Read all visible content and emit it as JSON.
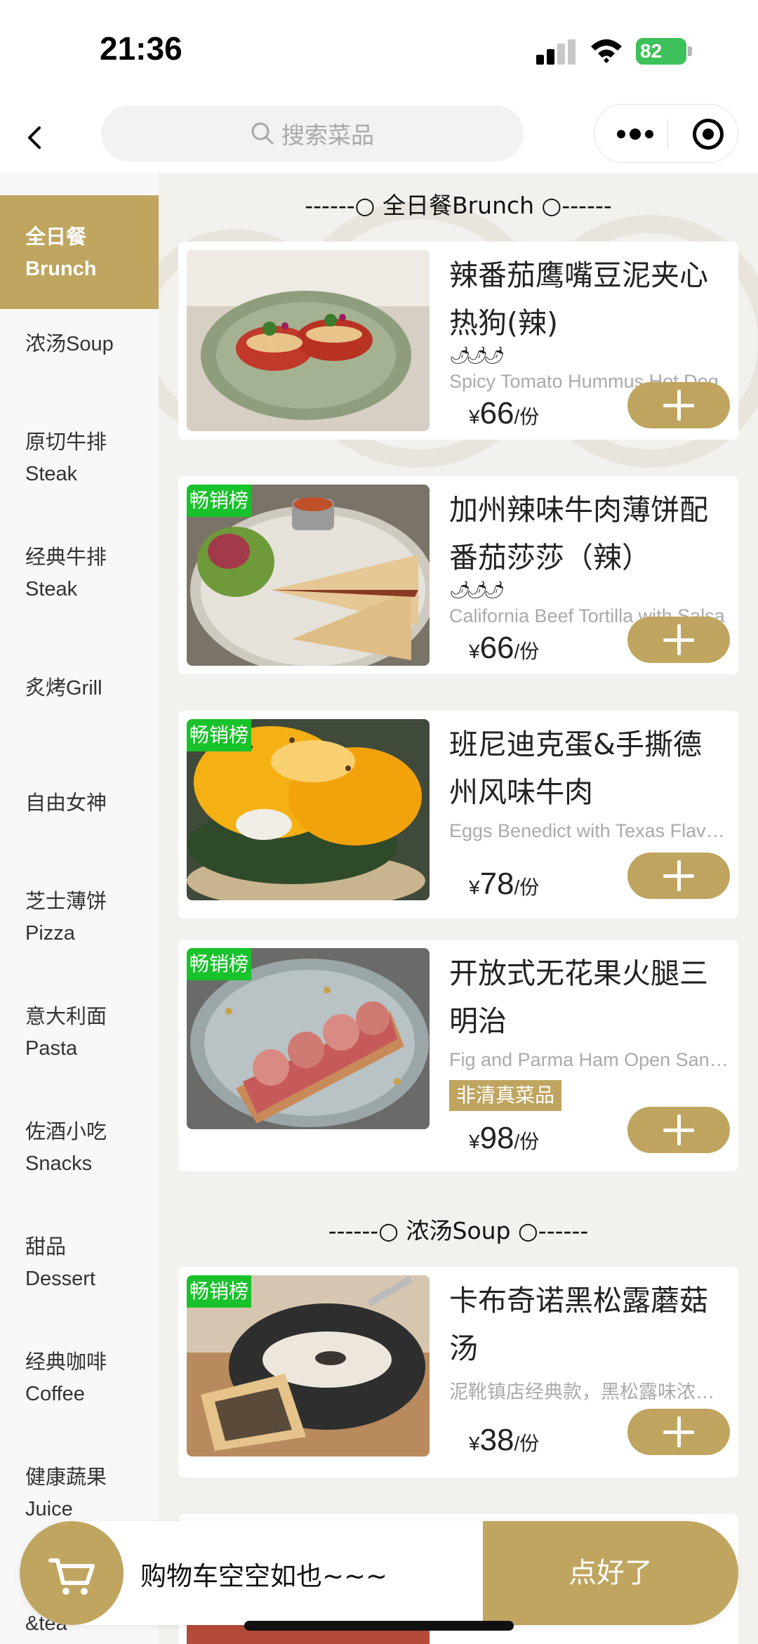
{
  "status_bar": {
    "time": "21:36",
    "battery": "82"
  },
  "nav": {
    "search_placeholder": "搜索菜品"
  },
  "categories": [
    {
      "l1": "全日餐",
      "l2": "Brunch",
      "active": true
    },
    {
      "l1": "浓汤Soup",
      "l2": ""
    },
    {
      "l1": "原切牛排",
      "l2": "Steak"
    },
    {
      "l1": "经典牛排",
      "l2": "Steak"
    },
    {
      "l1": "炙烤Grill",
      "l2": ""
    },
    {
      "l1": "自由女神",
      "l2": ""
    },
    {
      "l1": "芝士薄饼",
      "l2": "Pizza"
    },
    {
      "l1": "意大利面",
      "l2": "Pasta"
    },
    {
      "l1": "佐酒小吃",
      "l2": "Snacks"
    },
    {
      "l1": "甜品",
      "l2": "Dessert"
    },
    {
      "l1": "经典咖啡",
      "l2": "Coffee"
    },
    {
      "l1": "健康蔬果",
      "l2": "Juice"
    }
  ],
  "sidebar_peek": "&tea",
  "sections": [
    {
      "title": "------○ 全日餐Brunch ○------"
    },
    {
      "title": "------○ 浓汤Soup ○------"
    }
  ],
  "badge_text": "畅销榜",
  "dishes": [
    {
      "name": "辣番茄鹰嘴豆泥夹心热狗(辣)",
      "spicy": "🌶🌶🌶",
      "sub": "Spicy Tomato Hummus Hot Dog",
      "currency": "¥",
      "price": "66",
      "unit": "/份",
      "badge": false
    },
    {
      "name": "加州辣味牛肉薄饼配番茄莎莎（辣）",
      "spicy": "🌶🌶🌶",
      "sub": "California Beef Tortilla with Salsa",
      "currency": "¥",
      "price": "66",
      "unit": "/份",
      "badge": true
    },
    {
      "name": "班尼迪克蛋&手撕德州风味牛肉",
      "sub": "Eggs Benedict with Texas Flavor Beef",
      "currency": "¥",
      "price": "78",
      "unit": "/份",
      "badge": true
    },
    {
      "name": "开放式无花果火腿三明治",
      "sub": "Fig and Parma Ham Open Sandwich",
      "tag": "非清真菜品",
      "currency": "¥",
      "price": "98",
      "unit": "/份",
      "badge": true
    },
    {
      "name": "卡布奇诺黑松露蘑菇汤",
      "sub": "泥靴镇店经典款，黑松露味浓郁香醇",
      "currency": "¥",
      "price": "38",
      "unit": "/份",
      "badge": true
    }
  ],
  "cart": {
    "empty_text": "购物车空空如也~~~",
    "submit_label": "点好了"
  },
  "colors": {
    "accent": "#bfa560",
    "badge": "#17c22a"
  }
}
